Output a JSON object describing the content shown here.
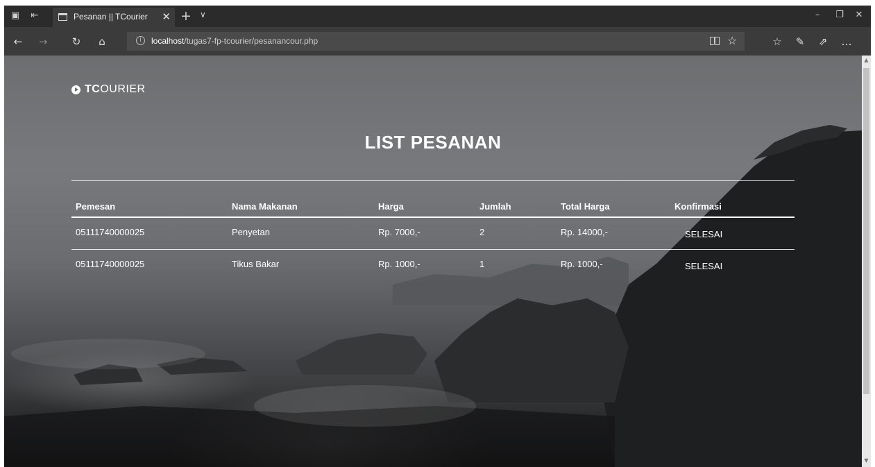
{
  "browser": {
    "tab_title": "Pesanan || TCourier",
    "url_host": "localhost",
    "url_path": "/tugas7-fp-tcourier/pesanancour.php"
  },
  "icons": {
    "tab_actions": "tab-actions-icon",
    "set_aside": "set-aside-tabs-icon",
    "back": "back-arrow-icon",
    "forward": "forward-arrow-icon",
    "refresh": "refresh-icon",
    "home": "home-icon",
    "info": "info-icon",
    "reading_view": "reading-view-icon",
    "favorite": "star-icon",
    "favorites_hub": "favorites-hub-icon",
    "pen": "pen-icon",
    "share": "share-icon",
    "more": "more-icon"
  },
  "page": {
    "brand_strong": "TC",
    "brand_rest": "OURIER",
    "title": "LIST PESANAN",
    "columns": [
      "Pemesan",
      "Nama Makanan",
      "Harga",
      "Jumlah",
      "Total Harga",
      "Konfirmasi"
    ],
    "rows": [
      [
        "05111740000025",
        "Penyetan",
        "Rp. 7000,-",
        "2",
        "Rp. 14000,-",
        "SELESAI"
      ],
      [
        "05111740000025",
        "Tikus Bakar",
        "Rp. 1000,-",
        "1",
        "Rp. 1000,-",
        "SELESAI"
      ]
    ]
  }
}
